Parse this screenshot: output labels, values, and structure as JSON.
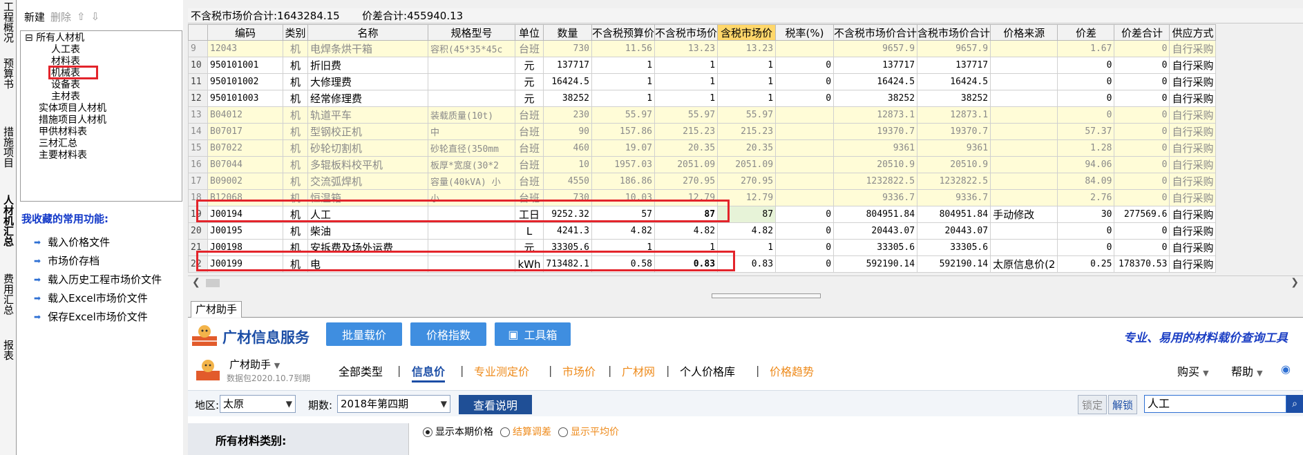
{
  "vertical_tabs": [
    {
      "label": "工程概况",
      "active": false
    },
    {
      "label": "预算书",
      "active": false
    },
    {
      "label": "措施项目",
      "active": false
    },
    {
      "label": "人材机汇总",
      "active": true
    },
    {
      "label": "费用汇总",
      "active": false
    },
    {
      "label": "报表",
      "active": false
    }
  ],
  "left_toolbar": {
    "new": "新建",
    "delete": "删除",
    "up": "⇧",
    "down": "⇩"
  },
  "tree": {
    "root": "所有人材机",
    "children": [
      "人工表",
      "材料表",
      "机械表",
      "设备表",
      "主材表"
    ],
    "others": [
      "实体项目人材机",
      "措施项目人材机",
      "甲供材料表",
      "三材汇总",
      "主要材料表"
    ]
  },
  "favorites": {
    "title": "我收藏的常用功能:",
    "items": [
      "载入价格文件",
      "市场价存档",
      "载入历史工程市场价文件",
      "载入Excel市场价文件",
      "保存Excel市场价文件"
    ]
  },
  "summary": {
    "pretax_total_label": "不含税市场价合计:",
    "pretax_total": "1643284.15",
    "diff_total_label": "价差合计:",
    "diff_total": "455940.13"
  },
  "table": {
    "columns": [
      "",
      "编码",
      "类别",
      "名称",
      "规格型号",
      "单位",
      "数量",
      "不含税预算价",
      "不含税市场价",
      "含税市场价",
      "税率(%)",
      "不含税市场价合计",
      "含税市场价合计",
      "价格来源",
      "价差",
      "价差合计",
      "供应方式"
    ],
    "rows": [
      [
        "9",
        "12043",
        "机",
        "电焊条烘干箱",
        "容积(45*35*45c",
        "台班",
        "730",
        "11.56",
        "13.23",
        "13.23",
        "",
        "9657.9",
        "9657.9",
        "",
        "1.67",
        "0",
        "自行采购"
      ],
      [
        "10",
        "950101001",
        "机",
        "折旧费",
        "",
        "元",
        "137717",
        "1",
        "1",
        "1",
        "0",
        "137717",
        "137717",
        "",
        "0",
        "0",
        "自行采购"
      ],
      [
        "11",
        "950101002",
        "机",
        "大修理费",
        "",
        "元",
        "16424.5",
        "1",
        "1",
        "1",
        "0",
        "16424.5",
        "16424.5",
        "",
        "0",
        "0",
        "自行采购"
      ],
      [
        "12",
        "950101003",
        "机",
        "经常修理费",
        "",
        "元",
        "38252",
        "1",
        "1",
        "1",
        "0",
        "38252",
        "38252",
        "",
        "0",
        "0",
        "自行采购"
      ],
      [
        "13",
        "B04012",
        "机",
        "轨道平车",
        "装载质量(10t)",
        "台班",
        "230",
        "55.97",
        "55.97",
        "55.97",
        "",
        "12873.1",
        "12873.1",
        "",
        "0",
        "0",
        "自行采购"
      ],
      [
        "14",
        "B07017",
        "机",
        "型钢校正机",
        "中",
        "台班",
        "90",
        "157.86",
        "215.23",
        "215.23",
        "",
        "19370.7",
        "19370.7",
        "",
        "57.37",
        "0",
        "自行采购"
      ],
      [
        "15",
        "B07022",
        "机",
        "砂轮切割机",
        "砂轮直径(350mm",
        "台班",
        "460",
        "19.07",
        "20.35",
        "20.35",
        "",
        "9361",
        "9361",
        "",
        "1.28",
        "0",
        "自行采购"
      ],
      [
        "16",
        "B07044",
        "机",
        "多辊板料校平机",
        "板厚*宽度(30*2",
        "台班",
        "10",
        "1957.03",
        "2051.09",
        "2051.09",
        "",
        "20510.9",
        "20510.9",
        "",
        "94.06",
        "0",
        "自行采购"
      ],
      [
        "17",
        "B09002",
        "机",
        "交流弧焊机",
        "容量(40kVA) 小",
        "台班",
        "4550",
        "186.86",
        "270.95",
        "270.95",
        "",
        "1232822.5",
        "1232822.5",
        "",
        "84.09",
        "0",
        "自行采购"
      ],
      [
        "18",
        "B12068",
        "机",
        "恒温箱",
        "小",
        "台班",
        "730",
        "10.03",
        "12.79",
        "12.79",
        "",
        "9336.7",
        "9336.7",
        "",
        "2.76",
        "0",
        "自行采购"
      ],
      [
        "19",
        "J00194",
        "机",
        "人工",
        "",
        "工日",
        "9252.32",
        "57",
        "87",
        "87",
        "0",
        "804951.84",
        "804951.84",
        "手动修改",
        "30",
        "277569.6",
        "自行采购"
      ],
      [
        "20",
        "J00195",
        "机",
        "柴油",
        "",
        "L",
        "4241.3",
        "4.82",
        "4.82",
        "4.82",
        "0",
        "20443.07",
        "20443.07",
        "",
        "0",
        "0",
        "自行采购"
      ],
      [
        "21",
        "J00198",
        "机",
        "安拆费及场外运费",
        "",
        "元",
        "33305.6",
        "1",
        "1",
        "1",
        "0",
        "33305.6",
        "33305.6",
        "",
        "0",
        "0",
        "自行采购"
      ],
      [
        "22",
        "J00199",
        "机",
        "电",
        "",
        "kWh",
        "713482.1",
        "0.58",
        "0.83",
        "0.83",
        "0",
        "592190.14",
        "592190.14",
        "太原信息价(2",
        "0.25",
        "178370.53",
        "自行采购"
      ]
    ]
  },
  "bottom_tab": "广材助手",
  "assistant": {
    "brand": "广材信息服务",
    "buttons": [
      "批量载价",
      "价格指数",
      "工具箱"
    ],
    "slogan": "专业、易用的材料载价查询工具",
    "nav_title": "广材助手",
    "nav_sub": "数据包2020.10.7到期",
    "nav_links": [
      "全部类型",
      "信息价",
      "专业测定价",
      "市场价",
      "广材网",
      "个人价格库",
      "价格趋势"
    ],
    "buy": "购买",
    "help": "帮助",
    "region_label": "地区:",
    "region_value": "太原",
    "period_label": "期数:",
    "period_value": "2018年第四期",
    "explain_button": "查看说明",
    "lock": "锁定",
    "unlock": "解锁",
    "search_value": "人工",
    "category_title": "所有材料类别:",
    "radios": [
      "显示本期价格",
      "结算调差",
      "显示平均价"
    ]
  }
}
